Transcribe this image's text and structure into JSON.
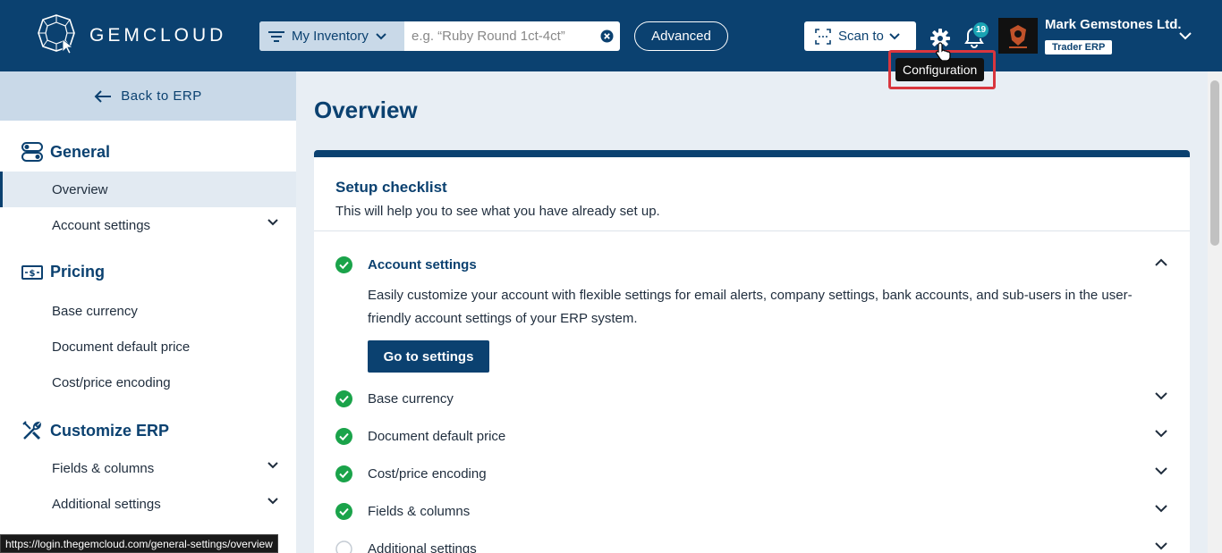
{
  "header": {
    "brand": "GEMCLOUD",
    "search": {
      "scope_label": "My Inventory",
      "placeholder": "e.g. “Ruby Round 1ct-4ct”",
      "value": ""
    },
    "advanced_label": "Advanced",
    "scan_label": "Scan to",
    "notifications_count": "19",
    "user": {
      "name": "Mark Gemstones Ltd.",
      "role": "Trader ERP"
    },
    "tooltip": "Configuration"
  },
  "sidebar": {
    "back_label": "Back to ERP",
    "sections": [
      {
        "title": "General",
        "icon": "toggles-icon",
        "items": [
          {
            "label": "Overview",
            "active": true
          },
          {
            "label": "Account settings",
            "expandable": true
          }
        ]
      },
      {
        "title": "Pricing",
        "icon": "money-icon",
        "items": [
          {
            "label": "Base currency"
          },
          {
            "label": "Document default price"
          },
          {
            "label": "Cost/price encoding"
          }
        ]
      },
      {
        "title": "Customize ERP",
        "icon": "tools-icon",
        "items": [
          {
            "label": "Fields & columns",
            "expandable": true
          },
          {
            "label": "Additional settings",
            "expandable": true
          }
        ]
      }
    ]
  },
  "main": {
    "title": "Overview",
    "checklist": {
      "title": "Setup checklist",
      "subtitle": "This will help you to see what you have already set up.",
      "items": [
        {
          "label": "Account settings",
          "done": true,
          "open": true
        },
        {
          "label": "Base currency",
          "done": true
        },
        {
          "label": "Document default price",
          "done": true
        },
        {
          "label": "Cost/price encoding",
          "done": true
        },
        {
          "label": "Fields & columns",
          "done": true
        },
        {
          "label": "Additional settings",
          "done": false
        }
      ],
      "open_description": "Easily customize your account with flexible settings for email alerts, company settings, bank accounts, and sub-users in the user-friendly account settings of your ERP system.",
      "open_button": "Go to settings"
    }
  },
  "statusbar": {
    "url": "https://login.thegemcloud.com/general-settings/overview"
  },
  "colors": {
    "primary": "#0b4170",
    "success": "#1aa34a",
    "highlight": "#d9363e"
  }
}
